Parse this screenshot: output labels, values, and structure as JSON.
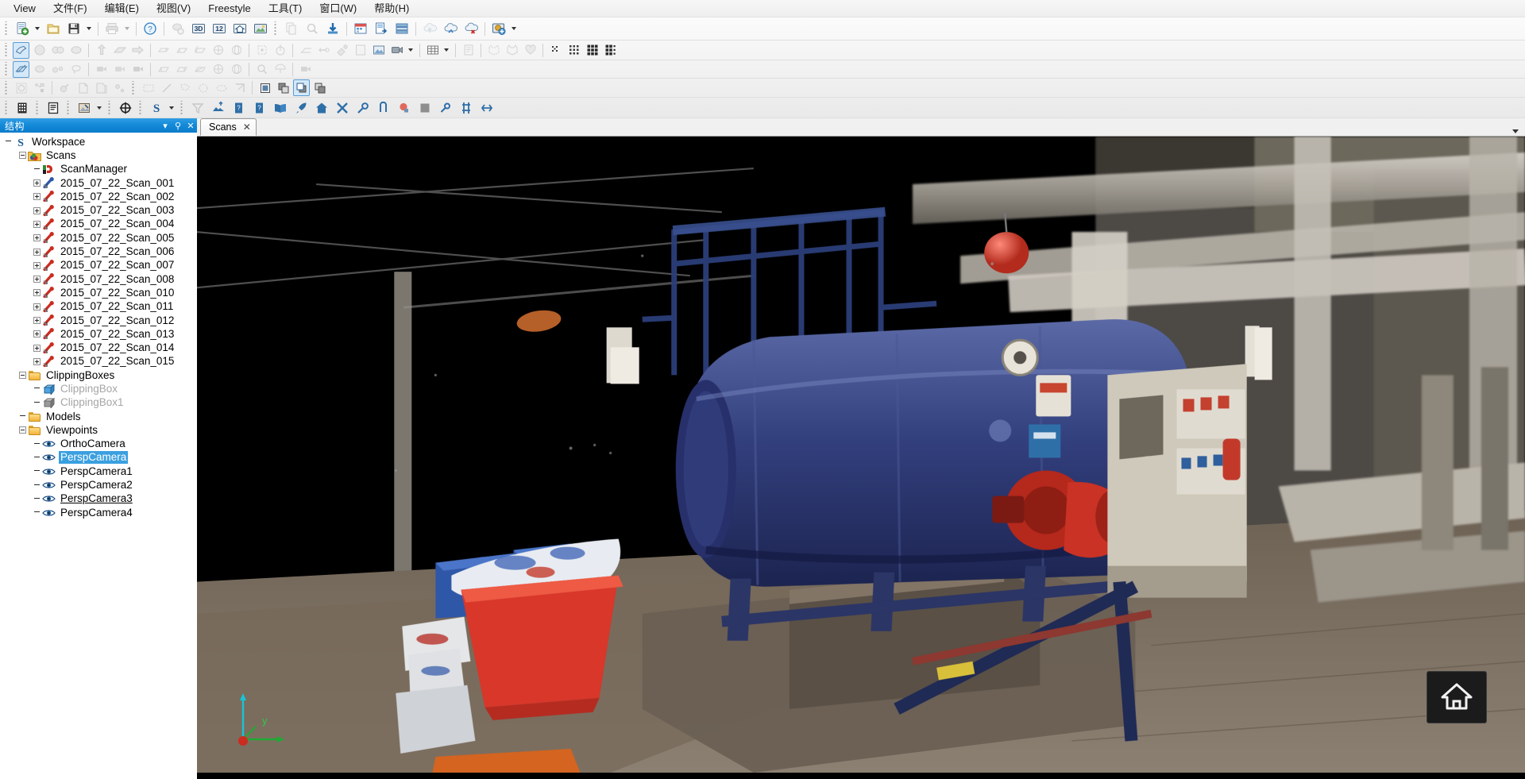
{
  "menubar": {
    "items": [
      {
        "label": "View",
        "name": "menu-view"
      },
      {
        "label": "文件(F)",
        "name": "menu-file"
      },
      {
        "label": "编辑(E)",
        "name": "menu-edit"
      },
      {
        "label": "视图(V)",
        "name": "menu-viewcn"
      },
      {
        "label": "Freestyle",
        "name": "menu-freestyle"
      },
      {
        "label": "工具(T)",
        "name": "menu-tools"
      },
      {
        "label": "窗口(W)",
        "name": "menu-window"
      },
      {
        "label": "帮助(H)",
        "name": "menu-help"
      }
    ]
  },
  "toolbars": {
    "row1": [
      {
        "icon": "new-project-icon",
        "dropdown": true,
        "disabled": false
      },
      {
        "icon": "open-folder-icon",
        "dropdown": false,
        "disabled": false
      },
      {
        "icon": "save-icon",
        "dropdown": true,
        "disabled": false
      },
      {
        "sep": true
      },
      {
        "icon": "print-icon",
        "dropdown": true,
        "disabled": true
      },
      {
        "sep": true
      },
      {
        "icon": "help-question-icon",
        "disabled": false
      },
      {
        "sep": true
      },
      {
        "icon": "render-settings-icon",
        "disabled": true
      },
      {
        "icon": "3d-view-icon",
        "disabled": false
      },
      {
        "icon": "12-view-icon",
        "disabled": false
      },
      {
        "icon": "home-view-icon",
        "disabled": false
      },
      {
        "icon": "image-view-icon",
        "disabled": false
      },
      {
        "grip": true
      },
      {
        "icon": "copy-page-icon",
        "disabled": true
      },
      {
        "icon": "search-object-icon",
        "disabled": true
      },
      {
        "icon": "import-down-icon",
        "disabled": false
      },
      {
        "sep": true
      },
      {
        "icon": "calendar-icon",
        "disabled": false
      },
      {
        "icon": "report-export-icon",
        "disabled": false
      },
      {
        "icon": "layers-stack-icon",
        "disabled": false
      },
      {
        "sep": true
      },
      {
        "icon": "cloud-upload-icon",
        "disabled": true
      },
      {
        "icon": "cloud-sync-icon",
        "disabled": false
      },
      {
        "icon": "cloud-delete-icon",
        "disabled": false
      },
      {
        "sep": true
      },
      {
        "icon": "add-scan-icon",
        "dropdown": true,
        "disabled": false
      }
    ],
    "row2": [
      {
        "icon": "select-region-icon",
        "active": true
      },
      {
        "icon": "sphere-icon",
        "disabled": true
      },
      {
        "icon": "pair-spheres-icon",
        "disabled": true
      },
      {
        "icon": "sphere-fit-icon",
        "disabled": true
      },
      {
        "sep": true
      },
      {
        "icon": "extrude-up-icon",
        "disabled": true
      },
      {
        "icon": "plane-fit-icon",
        "disabled": true
      },
      {
        "icon": "arrow-right-solid-icon",
        "disabled": true
      },
      {
        "sep": true
      },
      {
        "icon": "box-top-icon",
        "disabled": true
      },
      {
        "icon": "box-iso-icon",
        "disabled": true
      },
      {
        "icon": "box-side-icon",
        "disabled": true
      },
      {
        "icon": "sphere-wire-icon",
        "disabled": true
      },
      {
        "icon": "sphere-wire2-icon",
        "disabled": true
      },
      {
        "sep": true
      },
      {
        "icon": "target-point-icon",
        "disabled": true
      },
      {
        "icon": "axis-rotate-icon",
        "disabled": true
      },
      {
        "sep": true
      },
      {
        "icon": "plane-edge-icon",
        "disabled": true
      },
      {
        "icon": "pin-point-icon",
        "disabled": true
      },
      {
        "icon": "mesh-paint-icon",
        "disabled": true
      },
      {
        "icon": "page-blank-icon",
        "disabled": true
      },
      {
        "icon": "picture-icon",
        "disabled": false
      },
      {
        "icon": "video-capture-icon",
        "dropdown": true,
        "disabled": false
      },
      {
        "sep": true
      },
      {
        "icon": "grid-table-icon",
        "dropdown": true,
        "disabled": false
      },
      {
        "sep": true
      },
      {
        "icon": "note-page-icon",
        "disabled": true
      },
      {
        "sep": true
      },
      {
        "icon": "mesh-cat-icon",
        "disabled": true
      },
      {
        "icon": "mesh-cat2-icon",
        "disabled": true
      },
      {
        "icon": "heart-mesh-icon",
        "disabled": true
      },
      {
        "sep": true
      },
      {
        "icon": "dots-sparse-icon",
        "disabled": false
      },
      {
        "icon": "dots-medium-icon",
        "disabled": false
      },
      {
        "icon": "dots-dense-icon",
        "disabled": false
      },
      {
        "icon": "dots-mixed-icon",
        "disabled": false
      }
    ],
    "row3": [
      {
        "icon": "clip-plane-icon",
        "active": true
      },
      {
        "icon": "sphere-grey-icon",
        "disabled": true
      },
      {
        "icon": "binocular-icon",
        "disabled": true
      },
      {
        "icon": "lasso-icon",
        "disabled": true
      },
      {
        "sep": true
      },
      {
        "icon": "camera-video-icon",
        "disabled": true
      },
      {
        "icon": "camera-video2-icon",
        "disabled": true
      },
      {
        "icon": "camera-video3-icon",
        "disabled": true
      },
      {
        "sep": true
      },
      {
        "icon": "box-wire1-icon",
        "disabled": true
      },
      {
        "icon": "box-wire2-icon",
        "disabled": true
      },
      {
        "icon": "box-wire3-icon",
        "disabled": true
      },
      {
        "icon": "globe-wire1-icon",
        "disabled": true
      },
      {
        "icon": "globe-wire2-icon",
        "disabled": true
      },
      {
        "sep": true
      },
      {
        "icon": "magnifier-icon",
        "disabled": true
      },
      {
        "icon": "umbrella-icon",
        "disabled": true
      },
      {
        "sep": true
      },
      {
        "icon": "camcorder-icon",
        "disabled": true
      }
    ],
    "row4": [
      {
        "icon": "refresh-circle-icon",
        "disabled": true
      },
      {
        "icon": "node-link-icon",
        "disabled": true
      },
      {
        "sep": true
      },
      {
        "icon": "sphere-pin-icon",
        "disabled": true
      },
      {
        "icon": "page-curl-icon",
        "disabled": true
      },
      {
        "icon": "page-curl2-icon",
        "disabled": true
      },
      {
        "icon": "node-dot-icon",
        "disabled": true
      },
      {
        "grip": true
      },
      {
        "icon": "marquee-select-icon",
        "disabled": true
      },
      {
        "icon": "line-tool-icon",
        "disabled": true
      },
      {
        "icon": "polygon-select-icon",
        "disabled": true
      },
      {
        "icon": "circle-select-icon",
        "disabled": true
      },
      {
        "icon": "ellipse-select-icon",
        "disabled": true
      },
      {
        "icon": "corner-select-icon",
        "disabled": true
      },
      {
        "sep": true
      },
      {
        "icon": "fill-square-icon",
        "disabled": false
      },
      {
        "icon": "bring-forward-icon",
        "disabled": false
      },
      {
        "icon": "overlap-front-icon",
        "active": true
      },
      {
        "icon": "send-back-icon",
        "disabled": false
      }
    ],
    "row5": [
      {
        "icon": "building-icon",
        "disabled": false
      },
      {
        "grip": true
      },
      {
        "icon": "document-lines-icon",
        "disabled": false
      },
      {
        "grip": true
      },
      {
        "icon": "image-edit-icon",
        "dropdown": true,
        "disabled": false
      },
      {
        "grip": true
      },
      {
        "icon": "crosshair-circle-icon",
        "disabled": false
      },
      {
        "grip": true
      },
      {
        "icon": "s-logo-icon",
        "dropdown": true,
        "disabled": false
      },
      {
        "grip": true
      },
      {
        "icon": "filter-funnel-icon",
        "disabled": true
      },
      {
        "icon": "terrain-upload-icon",
        "disabled": false
      },
      {
        "icon": "book-q1-icon",
        "disabled": false
      },
      {
        "icon": "book-q2-icon",
        "disabled": false
      },
      {
        "icon": "open-book-icon",
        "disabled": false
      },
      {
        "icon": "rocket-icon",
        "disabled": false
      },
      {
        "icon": "house-icon",
        "disabled": false
      },
      {
        "icon": "tools-cross-icon",
        "disabled": false
      },
      {
        "icon": "gears-icon",
        "disabled": false
      },
      {
        "icon": "sync-arrows-icon",
        "disabled": false
      },
      {
        "icon": "red-sphere-icon",
        "disabled": false
      },
      {
        "icon": "grey-square-icon",
        "disabled": false
      },
      {
        "icon": "gear-small-icon",
        "disabled": false
      },
      {
        "icon": "network-nodes-icon",
        "disabled": false
      },
      {
        "icon": "arrows-expand-icon",
        "disabled": false
      }
    ]
  },
  "panel": {
    "title": "结构",
    "collapse_icon": "chevron-down-icon",
    "pin_icon": "pin-icon",
    "close_icon": "close-icon"
  },
  "tree": {
    "root": {
      "label": "Workspace",
      "icon": "s-workspace-icon"
    },
    "nodes": [
      {
        "label": "Scans",
        "icon": "folder-scans-icon",
        "depth": 1,
        "expander": "minus",
        "type": "folder"
      },
      {
        "label": "ScanManager",
        "icon": "scan-manager-icon",
        "depth": 2,
        "expander": "none",
        "type": "item"
      },
      {
        "label": "2015_07_22_Scan_001",
        "icon": "scan-blue-icon",
        "depth": 2,
        "expander": "plus",
        "type": "scan"
      },
      {
        "label": "2015_07_22_Scan_002",
        "icon": "scan-red-icon",
        "depth": 2,
        "expander": "plus",
        "type": "scan"
      },
      {
        "label": "2015_07_22_Scan_003",
        "icon": "scan-red-icon",
        "depth": 2,
        "expander": "plus",
        "type": "scan"
      },
      {
        "label": "2015_07_22_Scan_004",
        "icon": "scan-red-icon",
        "depth": 2,
        "expander": "plus",
        "type": "scan"
      },
      {
        "label": "2015_07_22_Scan_005",
        "icon": "scan-red-icon",
        "depth": 2,
        "expander": "plus",
        "type": "scan"
      },
      {
        "label": "2015_07_22_Scan_006",
        "icon": "scan-red-icon",
        "depth": 2,
        "expander": "plus",
        "type": "scan"
      },
      {
        "label": "2015_07_22_Scan_007",
        "icon": "scan-red-icon",
        "depth": 2,
        "expander": "plus",
        "type": "scan"
      },
      {
        "label": "2015_07_22_Scan_008",
        "icon": "scan-red-icon",
        "depth": 2,
        "expander": "plus",
        "type": "scan"
      },
      {
        "label": "2015_07_22_Scan_010",
        "icon": "scan-red-icon",
        "depth": 2,
        "expander": "plus",
        "type": "scan"
      },
      {
        "label": "2015_07_22_Scan_011",
        "icon": "scan-red-icon",
        "depth": 2,
        "expander": "plus",
        "type": "scan"
      },
      {
        "label": "2015_07_22_Scan_012",
        "icon": "scan-red-icon",
        "depth": 2,
        "expander": "plus",
        "type": "scan"
      },
      {
        "label": "2015_07_22_Scan_013",
        "icon": "scan-red-icon",
        "depth": 2,
        "expander": "plus",
        "type": "scan"
      },
      {
        "label": "2015_07_22_Scan_014",
        "icon": "scan-red-icon",
        "depth": 2,
        "expander": "plus",
        "type": "scan"
      },
      {
        "label": "2015_07_22_Scan_015",
        "icon": "scan-red-icon",
        "depth": 2,
        "expander": "plus",
        "type": "scan"
      },
      {
        "label": "ClippingBoxes",
        "icon": "folder-icon",
        "depth": 1,
        "expander": "minus",
        "type": "folder"
      },
      {
        "label": "ClippingBox",
        "icon": "clipbox-blue-icon",
        "depth": 2,
        "expander": "none",
        "type": "item",
        "state": "dim"
      },
      {
        "label": "ClippingBox1",
        "icon": "clipbox-grey-icon",
        "depth": 2,
        "expander": "none",
        "type": "item",
        "state": "dim"
      },
      {
        "label": "Models",
        "icon": "folder-icon",
        "depth": 1,
        "expander": "none",
        "type": "folder"
      },
      {
        "label": "Viewpoints",
        "icon": "folder-icon",
        "depth": 1,
        "expander": "minus",
        "type": "folder"
      },
      {
        "label": "OrthoCamera",
        "icon": "eye-icon",
        "depth": 2,
        "expander": "none",
        "type": "item"
      },
      {
        "label": "PerspCamera",
        "icon": "eye-icon",
        "depth": 2,
        "expander": "none",
        "type": "item",
        "state": "selected"
      },
      {
        "label": "PerspCamera1",
        "icon": "eye-icon",
        "depth": 2,
        "expander": "none",
        "type": "item"
      },
      {
        "label": "PerspCamera2",
        "icon": "eye-icon",
        "depth": 2,
        "expander": "none",
        "type": "item"
      },
      {
        "label": "PerspCamera3",
        "icon": "eye-icon",
        "depth": 2,
        "expander": "none",
        "type": "item",
        "state": "underline"
      },
      {
        "label": "PerspCamera4",
        "icon": "eye-icon",
        "depth": 2,
        "expander": "none",
        "type": "item"
      }
    ]
  },
  "view": {
    "tab": {
      "label": "Scans",
      "close": "✕"
    },
    "overflow_icon": "chevron-down-icon",
    "gizmo": {
      "x_label": "",
      "y_label": "y",
      "z_label": ""
    },
    "home_button_icon": "home-nav-icon"
  },
  "colors": {
    "accent": "#1289d8",
    "selection": "#3aa0e0",
    "toolbar_bg": "#f1f1f1",
    "viewport_bg": "#000000",
    "boiler_blue": "#3a4d86",
    "bucket_red": "#c82f23",
    "floor_brown": "#6c5c4e"
  }
}
